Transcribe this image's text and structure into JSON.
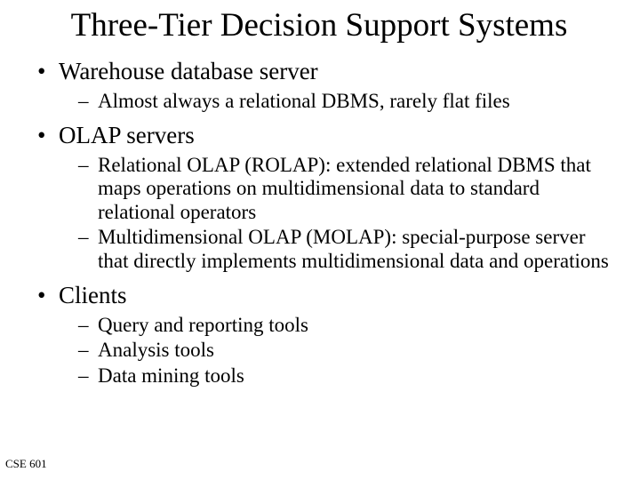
{
  "title": "Three-Tier Decision Support Systems",
  "bullets": [
    {
      "text": "Warehouse database server",
      "subs": [
        "Almost always a relational DBMS, rarely flat files"
      ]
    },
    {
      "text": "OLAP servers",
      "subs": [
        "Relational OLAP (ROLAP): extended relational DBMS that maps operations on multidimensional data to standard relational operators",
        "Multidimensional OLAP (MOLAP): special-purpose server that directly implements multidimensional data and operations"
      ]
    },
    {
      "text": "Clients",
      "subs": [
        "Query and reporting tools",
        "Analysis tools",
        "Data mining tools"
      ]
    }
  ],
  "footer": "CSE 601"
}
